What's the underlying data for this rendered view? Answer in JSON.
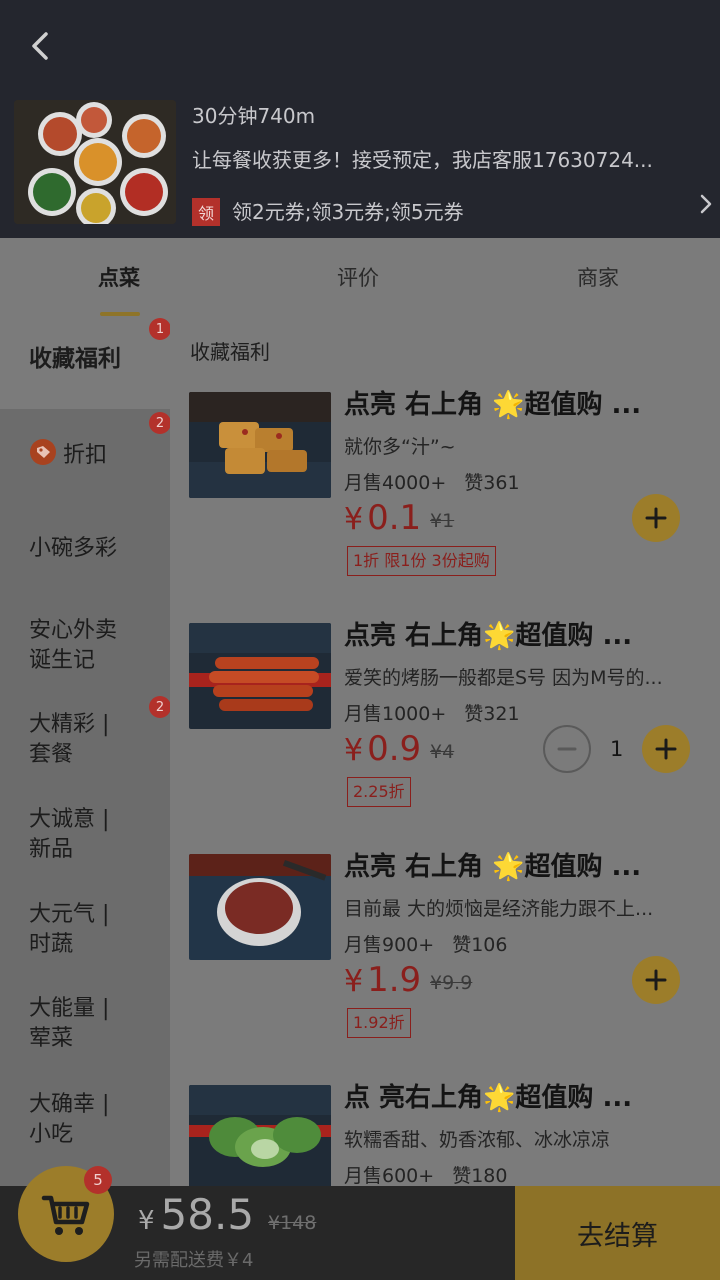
{
  "header": {
    "delivery_info": "30分钟740m",
    "notice": "让每餐收获更多！接受预定，我店客服17630724...",
    "coupon_tag": "领",
    "coupons": "领2元券;领3元券;领5元券"
  },
  "tabs": [
    {
      "label": "点菜"
    },
    {
      "label": "评价"
    },
    {
      "label": "商家"
    }
  ],
  "sidebar": {
    "items": [
      {
        "label": "收藏福利",
        "badge": "1"
      },
      {
        "label": "折扣",
        "badge": "2"
      },
      {
        "label": "小碗多彩"
      },
      {
        "label": "安心外卖\n诞生记"
      },
      {
        "label": "大精彩 |\n套餐",
        "badge": "2"
      },
      {
        "label": "大诚意 |\n新品"
      },
      {
        "label": "大元气 |\n时蔬"
      },
      {
        "label": "大能量 |\n荤菜"
      },
      {
        "label": "大确幸 |\n小吃"
      }
    ]
  },
  "main": {
    "section_title": "收藏福利",
    "dishes": [
      {
        "name": "点亮 右上角 🌟超值购 ...",
        "desc": "就你多“汁”~",
        "sales": "月售4000+",
        "likes": "赞361",
        "price_symbol": "¥",
        "price": "0.1",
        "original_price": "¥1",
        "discount": "1折 限1份 3份起购"
      },
      {
        "name": "点亮 右上角🌟超值购 ...",
        "desc": "爱笑的烤肠一般都是S号 因为M号的...",
        "sales": "月售1000+",
        "likes": "赞321",
        "price_symbol": "¥",
        "price": "0.9",
        "original_price": "¥4",
        "discount": "2.25折",
        "quantity": "1"
      },
      {
        "name": "点亮 右上角 🌟超值购 ...",
        "desc": "目前最 大的烦恼是经济能力跟不上...",
        "sales": "月售900+",
        "likes": "赞106",
        "price_symbol": "¥",
        "price": "1.9",
        "original_price": "¥9.9",
        "discount": "1.92折"
      },
      {
        "name": "点 亮右上角🌟超值购 ...",
        "desc": "软糯香甜、奶香浓郁、冰冰凉凉",
        "sales": "月售600+",
        "likes": "赞180"
      }
    ]
  },
  "cart": {
    "count": "5",
    "total_symbol": "¥",
    "total": "58.5",
    "original_total": "¥148",
    "delivery_fee": "另需配送费￥4",
    "checkout_label": "去结算"
  },
  "colors": {
    "accent": "#9c7d2a",
    "price_red": "#8a1f1c",
    "badge_red": "#b3312b"
  }
}
